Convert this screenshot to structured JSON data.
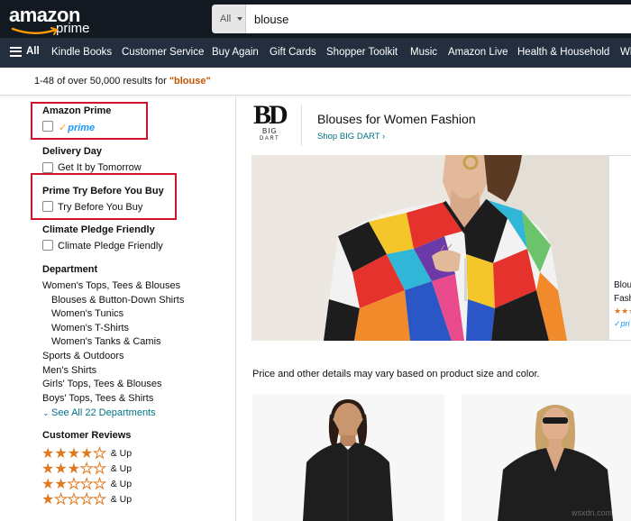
{
  "header": {
    "logo_text": "amazon",
    "logo_sub": "prime",
    "search_category": "All",
    "search_value": "blouse"
  },
  "nav": {
    "all_label": "All",
    "links": [
      "Kindle Books",
      "Customer Service",
      "Buy Again",
      "Gift Cards",
      "Shopper Toolkit",
      "Music",
      "Amazon Live",
      "Health & Household",
      "Wh"
    ]
  },
  "results": {
    "prefix": "1-48 of over 50,000 results for ",
    "query": "\"blouse\""
  },
  "sidebar": {
    "amazon_prime": {
      "heading": "Amazon Prime",
      "badge": "prime"
    },
    "delivery_day": {
      "heading": "Delivery Day",
      "option": "Get It by Tomorrow"
    },
    "try_before": {
      "heading": "Prime Try Before You Buy",
      "option": "Try Before You Buy"
    },
    "climate": {
      "heading": "Climate Pledge Friendly",
      "option": "Climate Pledge Friendly"
    },
    "department": {
      "heading": "Department",
      "items": [
        {
          "label": "Women's Tops, Tees & Blouses",
          "indent": false
        },
        {
          "label": "Blouses & Button-Down Shirts",
          "indent": true
        },
        {
          "label": "Women's Tunics",
          "indent": true
        },
        {
          "label": "Women's T-Shirts",
          "indent": true
        },
        {
          "label": "Women's Tanks & Camis",
          "indent": true
        },
        {
          "label": "Sports & Outdoors",
          "indent": false
        },
        {
          "label": "Men's Shirts",
          "indent": false
        },
        {
          "label": "Girls' Tops, Tees & Blouses",
          "indent": false
        },
        {
          "label": "Boys' Tops, Tees & Shirts",
          "indent": false
        }
      ],
      "see_all": "See All 22 Departments"
    },
    "reviews": {
      "heading": "Customer Reviews",
      "and_up": "& Up",
      "ratings": [
        4,
        3,
        2,
        1
      ]
    }
  },
  "brand": {
    "logo_letters": "BD",
    "logo_big": "BIG",
    "logo_dart": "DART",
    "title": "Blouses for Women Fashion",
    "shop_link": "Shop BIG DART ›"
  },
  "side_card": {
    "line1": "Blou",
    "line2": "Fash"
  },
  "price_note": "Price and other details may vary based on product size and color.",
  "watermark": "wsxdn.com",
  "colors": {
    "header_bg": "#131921",
    "nav_bg": "#232f3e",
    "link": "#007185",
    "query": "#c45500",
    "highlight_box": "#d0142a",
    "star": "#de7921",
    "prime_blue": "#1a98ff"
  }
}
